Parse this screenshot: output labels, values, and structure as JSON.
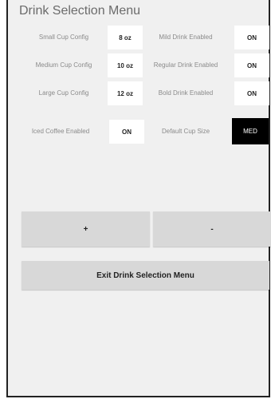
{
  "window": {
    "title": "Drink Selection Menu"
  },
  "settings": {
    "small_cup": {
      "label": "Small Cup Config",
      "value": "8 oz"
    },
    "medium_cup": {
      "label": "Medium Cup Config",
      "value": "10 oz"
    },
    "large_cup": {
      "label": "Large Cup Config",
      "value": "12 oz"
    },
    "iced_coffee": {
      "label": "Iced Coffee Enabled",
      "value": "ON"
    },
    "mild_drink": {
      "label": "Mild Drink Enabled",
      "value": "ON"
    },
    "regular_drink": {
      "label": "Regular Drink Enabled",
      "value": "ON"
    },
    "bold_drink": {
      "label": "Bold Drink Enabled",
      "value": "ON"
    },
    "default_cup": {
      "label": "Default Cup Size",
      "value": "MED"
    }
  },
  "controls": {
    "plus_label": "+",
    "minus_label": "-",
    "exit_label": "Exit Drink Selection Menu"
  },
  "colors": {
    "background": "#f0f0f0",
    "value_box": "#ffffff",
    "selected_box": "#000000",
    "button": "#d8d8d8"
  }
}
